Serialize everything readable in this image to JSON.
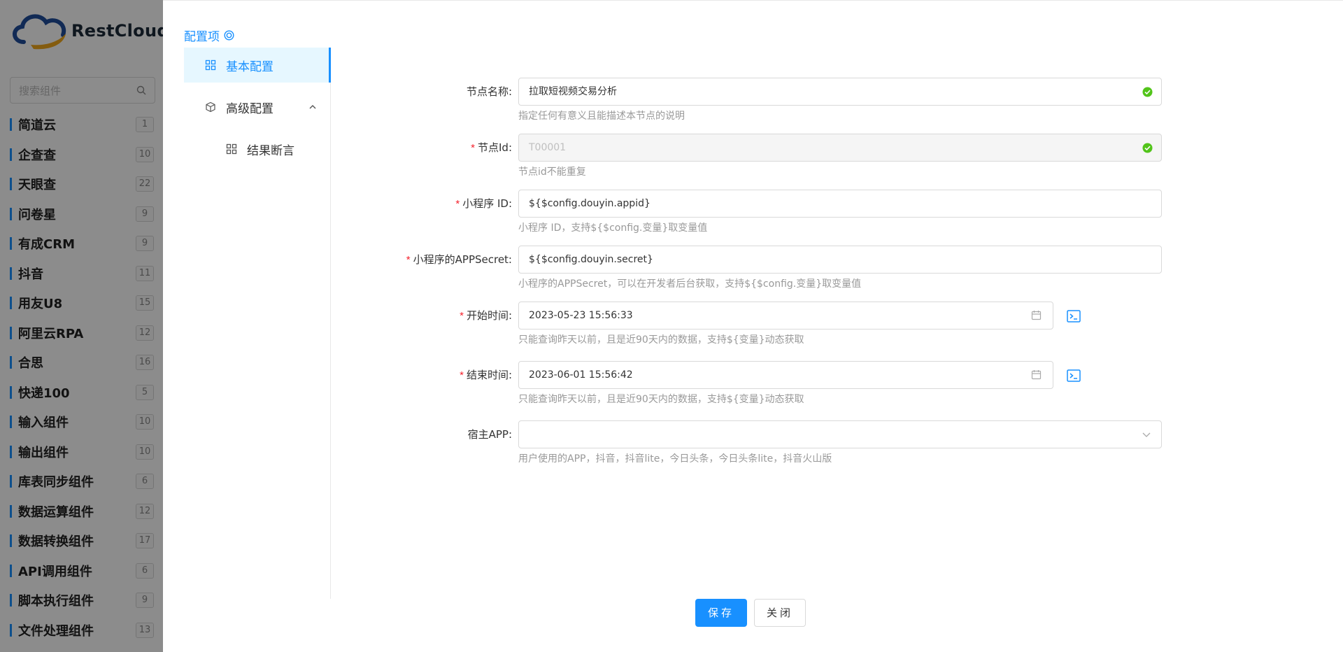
{
  "sidebar": {
    "brand": "RestCloud",
    "search_placeholder": "搜索组件",
    "categories": [
      {
        "label": "简道云",
        "count": "1"
      },
      {
        "label": "企查查",
        "count": "10"
      },
      {
        "label": "天眼查",
        "count": "22"
      },
      {
        "label": "问卷星",
        "count": "9"
      },
      {
        "label": "有成CRM",
        "count": "9"
      },
      {
        "label": "抖音",
        "count": "11"
      },
      {
        "label": "用友U8",
        "count": "15"
      },
      {
        "label": "阿里云RPA",
        "count": "12"
      },
      {
        "label": "合思",
        "count": "16"
      },
      {
        "label": "快递100",
        "count": "5"
      },
      {
        "label": "输入组件",
        "count": "10"
      },
      {
        "label": "输出组件",
        "count": "10"
      },
      {
        "label": "库表同步组件",
        "count": "6"
      },
      {
        "label": "数据运算组件",
        "count": "12"
      },
      {
        "label": "数据转换组件",
        "count": "17"
      },
      {
        "label": "API调用组件",
        "count": "6"
      },
      {
        "label": "脚本执行组件",
        "count": "9"
      },
      {
        "label": "文件处理组件",
        "count": "13"
      }
    ]
  },
  "config": {
    "title": "配置项",
    "menu": {
      "basic": "基本配置",
      "advanced": "高级配置",
      "assert": "结果断言"
    }
  },
  "form": {
    "node_name": {
      "label": "节点名称:",
      "value": "拉取短视频交易分析",
      "help": "指定任何有意义且能描述本节点的说明"
    },
    "node_id": {
      "label": "节点Id:",
      "value": "T00001",
      "help": "节点id不能重复"
    },
    "app_id": {
      "label": "小程序 ID:",
      "value": "${$config.douyin.appid}",
      "help": "小程序 ID，支持${$config.变量}取变量值"
    },
    "app_secret": {
      "label": "小程序的APPSecret:",
      "value": "${$config.douyin.secret}",
      "help": "小程序的APPSecret，可以在开发者后台获取，支持${$config.变量}取变量值"
    },
    "start_time": {
      "label": "开始时间:",
      "value": "2023-05-23 15:56:33",
      "help": "只能查询昨天以前，且是近90天内的数据，支持${变量}动态获取"
    },
    "end_time": {
      "label": "结束时间:",
      "value": "2023-06-01 15:56:42",
      "help": "只能查询昨天以前，且是近90天内的数据，支持${变量}动态获取"
    },
    "host_app": {
      "label": "宿主APP:",
      "value": "",
      "help": "用户使用的APP，抖音，抖音lite，今日头条，今日头条lite，抖音火山版"
    }
  },
  "buttons": {
    "save": "保存",
    "close": "关闭"
  },
  "colors": {
    "accent": "#1890ff",
    "success": "#52c41a",
    "required": "#f5222d"
  }
}
